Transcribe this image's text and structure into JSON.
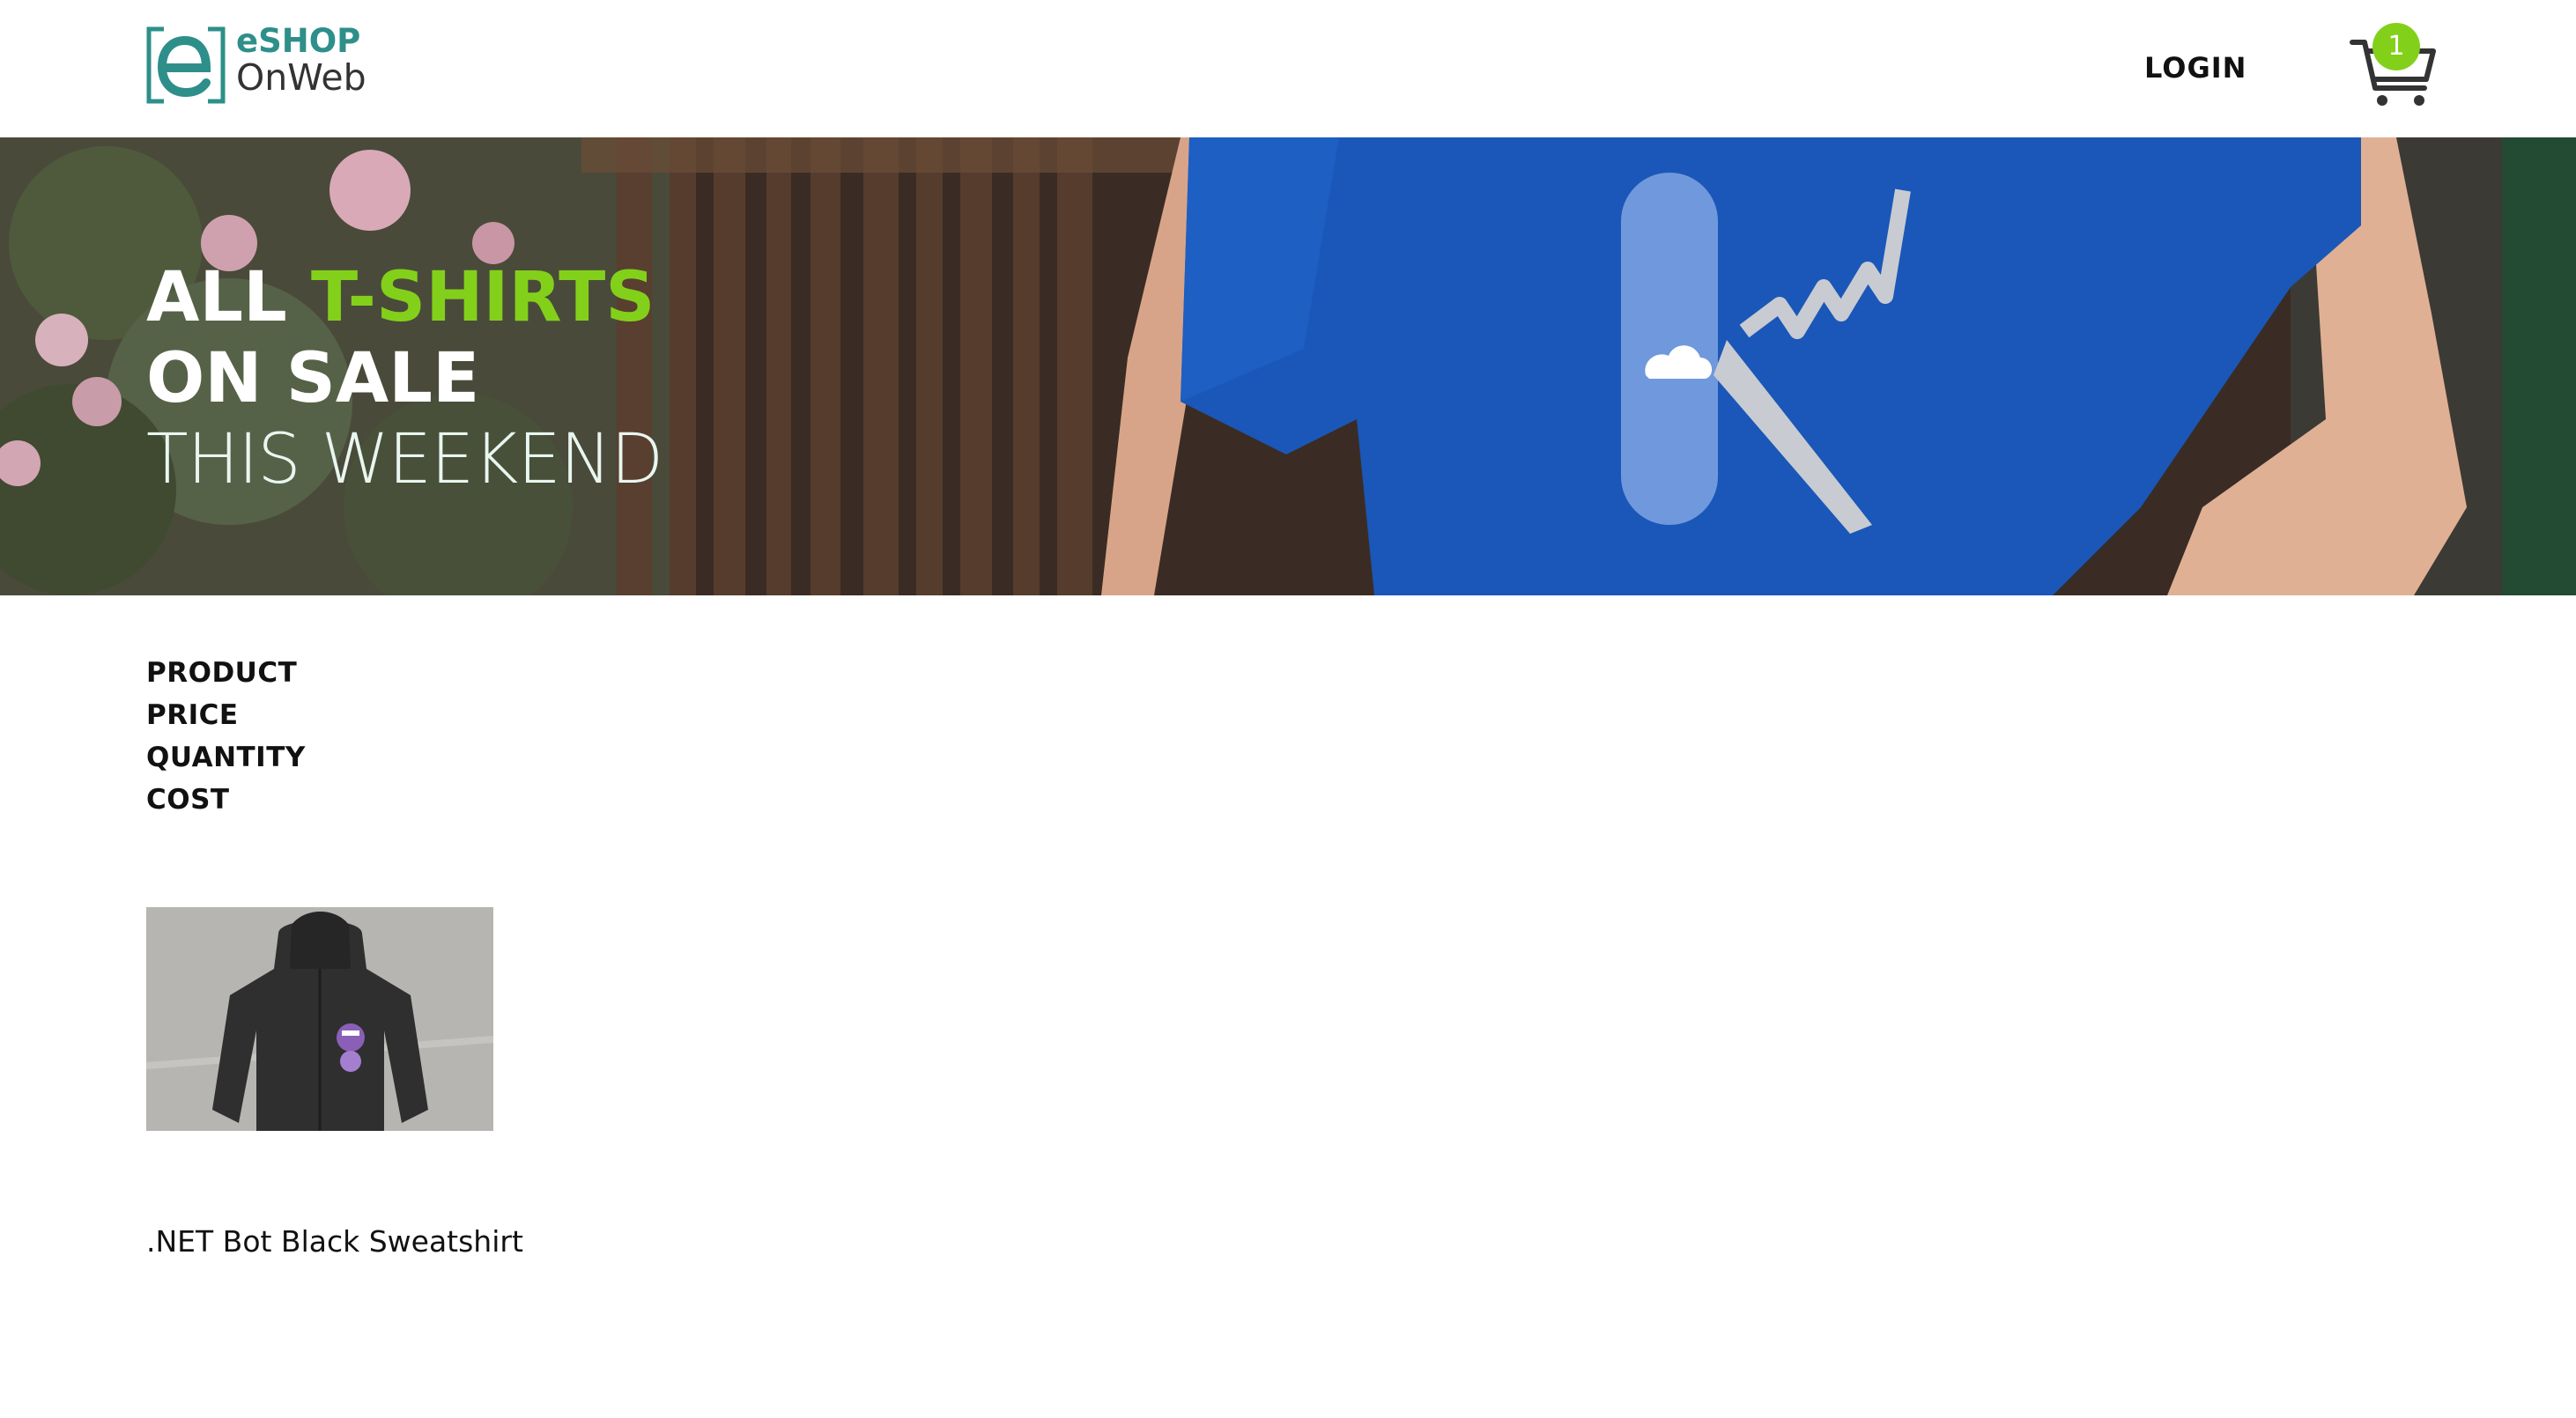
{
  "header": {
    "logo_line1": "eSHOP",
    "logo_line2": "OnWeb",
    "login_label": "LOGIN",
    "cart_count": "1",
    "cart_icon": "shopping-cart-icon"
  },
  "hero": {
    "line1_prefix": "ALL ",
    "line1_accent": "T-SHIRTS",
    "line2": "ON SALE",
    "line3": "THIS WEEKEND"
  },
  "basket": {
    "columns": [
      "PRODUCT",
      "PRICE",
      "QUANTITY",
      "COST"
    ],
    "items": [
      {
        "name": ".NET Bot Black Sweatshirt"
      }
    ]
  },
  "colors": {
    "accent_green": "#83d01b",
    "logo_teal": "#2e8f8a",
    "shirt_blue": "#1a57b8"
  }
}
